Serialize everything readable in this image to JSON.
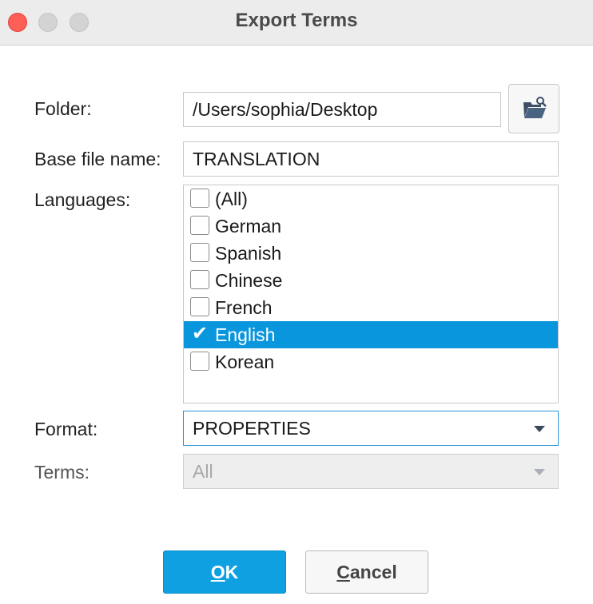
{
  "window": {
    "title": "Export Terms"
  },
  "form": {
    "folder_label": "Folder:",
    "folder_value": "/Users/sophia/Desktop",
    "browse_icon": "folder-open-icon",
    "base_label": "Base file name:",
    "base_value": "TRANSLATION",
    "languages_label": "Languages:",
    "languages": [
      {
        "label": "(All)",
        "checked": false,
        "selected": false
      },
      {
        "label": "German",
        "checked": false,
        "selected": false
      },
      {
        "label": "Spanish",
        "checked": false,
        "selected": false
      },
      {
        "label": "Chinese",
        "checked": false,
        "selected": false
      },
      {
        "label": "French",
        "checked": false,
        "selected": false
      },
      {
        "label": "English",
        "checked": true,
        "selected": true
      },
      {
        "label": "Korean",
        "checked": false,
        "selected": false
      }
    ],
    "format_label": "Format:",
    "format_value": "PROPERTIES",
    "terms_label": "Terms:",
    "terms_value": "All"
  },
  "buttons": {
    "ok_mnemonic": "O",
    "ok_rest": "K",
    "cancel_mnemonic": "C",
    "cancel_rest": "ancel"
  },
  "colors": {
    "selection": "#0a96dc",
    "ok_button": "#0fa0e2",
    "close_button": "#fe5f57"
  }
}
